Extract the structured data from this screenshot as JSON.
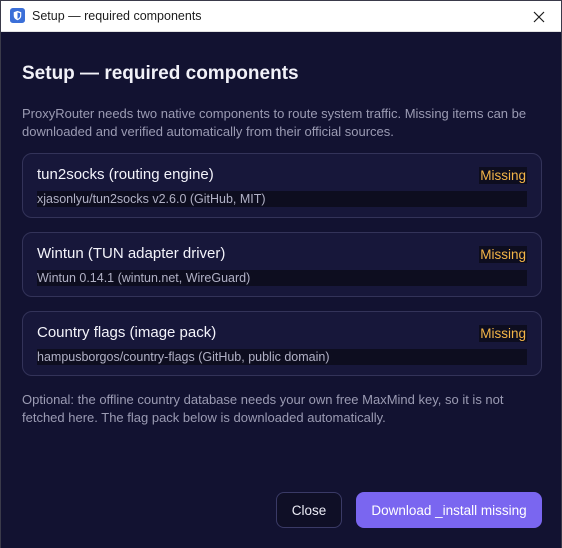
{
  "window": {
    "title": "Setup — required components",
    "accent": "#7a66f0",
    "status_color": "#f4b548"
  },
  "dialog": {
    "heading": "Setup — required components",
    "intro": "ProxyRouter needs two native components to route system traffic. Missing items can be downloaded and verified automatically from their official sources.",
    "components": [
      {
        "name": "tun2socks (routing engine)",
        "source": "xjasonlyu/tun2socks v2.6.0 (GitHub, MIT)",
        "status": "Missing"
      },
      {
        "name": "Wintun (TUN adapter driver)",
        "source": "Wintun 0.14.1 (wintun.net, WireGuard)",
        "status": "Missing"
      },
      {
        "name": "Country flags (image pack)",
        "source": "hampusborgos/country-flags (GitHub, public domain)",
        "status": "Missing"
      }
    ],
    "optional_note": "Optional: the offline country database needs your own free MaxMind key, so it is not fetched here. The flag pack below is downloaded automatically."
  },
  "buttons": {
    "close": "Close",
    "download": "Download _install missing"
  },
  "icons": {
    "app": "shield-icon",
    "close": "close-icon"
  }
}
